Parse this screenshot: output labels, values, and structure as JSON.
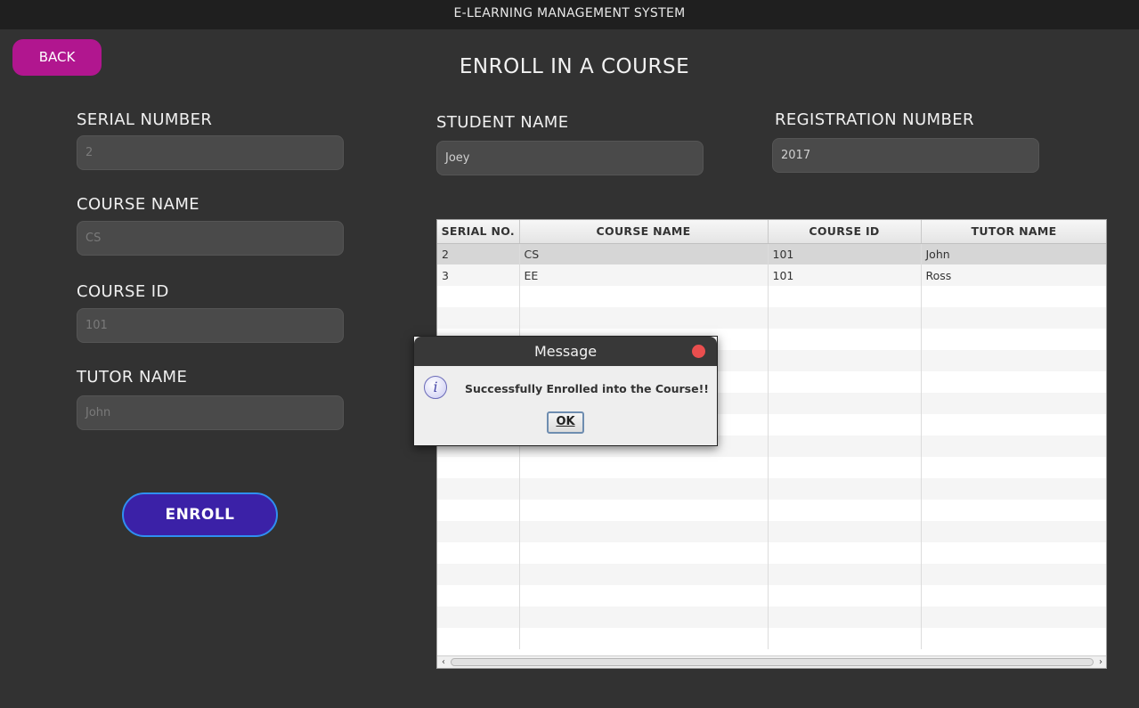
{
  "window": {
    "title": "E-LEARNING MANAGEMENT SYSTEM"
  },
  "back_label": "BACK",
  "page_title": "ENROLL IN A COURSE",
  "form": {
    "serial_number": {
      "label": "SERIAL NUMBER",
      "value": "2"
    },
    "course_name": {
      "label": "COURSE NAME",
      "value": "CS"
    },
    "course_id": {
      "label": "COURSE ID",
      "value": "101"
    },
    "tutor_name": {
      "label": "TUTOR NAME",
      "value": "John"
    },
    "student_name": {
      "label": "STUDENT NAME",
      "value": "Joey"
    },
    "registration_number": {
      "label": "REGISTRATION NUMBER",
      "value": "2017"
    },
    "enroll_label": "ENROLL"
  },
  "table": {
    "columns": [
      "SERIAL NO.",
      "COURSE NAME",
      "COURSE ID",
      "TUTOR NAME"
    ],
    "rows": [
      [
        "2",
        "CS",
        "101",
        "John"
      ],
      [
        "3",
        "EE",
        "101",
        "Ross"
      ]
    ],
    "selected_row": 0
  },
  "dialog": {
    "title": "Message",
    "message": "Successfully Enrolled into the Course!!",
    "ok_label": "OK",
    "icon": "info-icon"
  },
  "colors": {
    "background": "#323232",
    "back_button": "#b1168f",
    "enroll_button": "#3b21a7",
    "enroll_border": "#2f8ff0",
    "close_dot": "#e94e4e"
  }
}
